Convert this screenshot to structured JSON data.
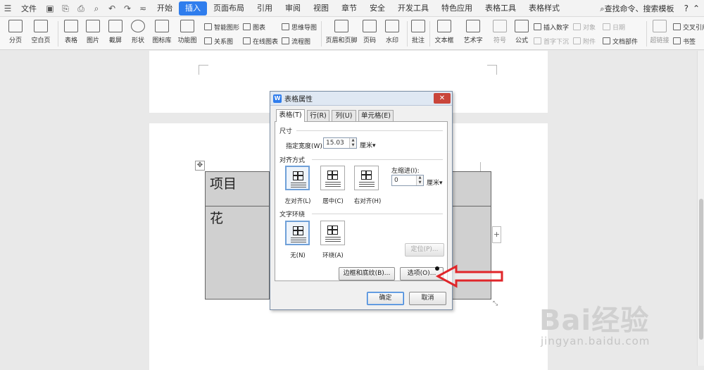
{
  "menubar": {
    "file_label": "文件",
    "tabs": [
      "开始",
      "插入",
      "页面布局",
      "引用",
      "审阅",
      "视图",
      "章节",
      "安全",
      "开发工具",
      "特色应用",
      "表格工具",
      "表格样式"
    ],
    "active_tab": "插入",
    "search_label": "查找命令、搜索模板",
    "help_label": "?"
  },
  "ribbon": {
    "page_break": "分页",
    "blank_page": "空白页",
    "table": "表格",
    "picture": "图片",
    "screenshot": "截屏",
    "shape": "形状",
    "icon_lib": "图标库",
    "function_chart": "功能图",
    "smart_art": "智能图形",
    "chart": "图表",
    "mind_map": "思维导图",
    "relation": "关系图",
    "online_chart": "在线图表",
    "flowchart": "流程图",
    "header_footer": "页眉和页脚",
    "page_num": "页码",
    "watermark": "水印",
    "comment": "批注",
    "text_box": "文本框",
    "word_art": "艺术字",
    "symbol": "符号",
    "formula": "公式",
    "insert_number": "插入数字",
    "first_drop": "首字下沉",
    "object": "对象",
    "attachment": "附件",
    "date": "日期",
    "doc_parts": "文档部件",
    "hyperlink": "超链接",
    "cross_ref": "交叉引用",
    "bookmark": "书签"
  },
  "document": {
    "cell_1": "项目",
    "cell_2": "花",
    "add_col": "+"
  },
  "dialog": {
    "title": "表格属性",
    "close": "✕",
    "tabs": [
      "表格(T)",
      "行(R)",
      "列(U)",
      "单元格(E)"
    ],
    "size_section": "尺寸",
    "width_label": "指定宽度(W):",
    "width_value": "15.03",
    "width_unit": "厘米▾",
    "align_section": "对齐方式",
    "align_left": "左对齐(L)",
    "align_center": "居中(C)",
    "align_right": "右对齐(H)",
    "indent_label": "左缩进(I):",
    "indent_value": "0",
    "indent_unit": "厘米▾",
    "wrap_section": "文字环绕",
    "wrap_none": "无(N)",
    "wrap_around": "环绕(A)",
    "position_btn": "定位(P)...",
    "borders_btn": "边框和底纹(B)...",
    "options_btn": "选项(O)...",
    "ok_btn": "确定",
    "cancel_btn": "取消"
  },
  "watermark": {
    "brand": "Bai经验",
    "url": "jingyan.baidu.com"
  },
  "colors": {
    "accent": "#2f7ded",
    "arrow": "#e0262a",
    "table_fill": "#d0d0d0"
  }
}
